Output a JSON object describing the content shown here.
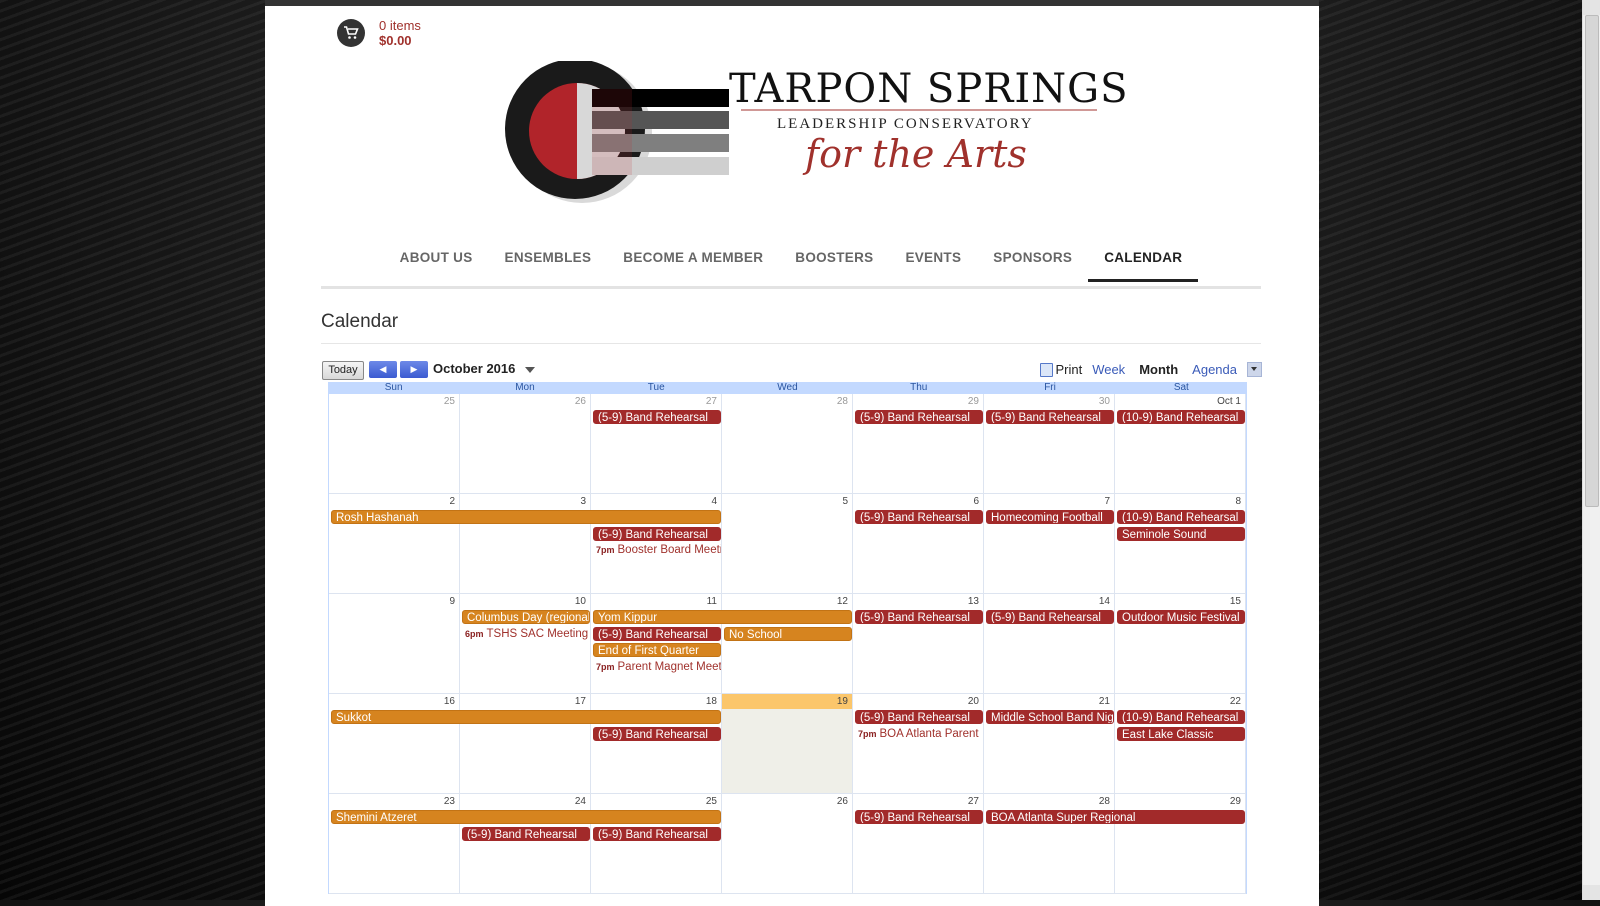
{
  "cart": {
    "items": "0 items",
    "total": "$0.00"
  },
  "brand": {
    "title": "TARPON SPRINGS",
    "subtitle": "LEADERSHIP CONSERVATORY",
    "script": "for the Arts"
  },
  "nav": [
    {
      "label": "ABOUT US"
    },
    {
      "label": "ENSEMBLES"
    },
    {
      "label": "BECOME A MEMBER"
    },
    {
      "label": "BOOSTERS"
    },
    {
      "label": "EVENTS"
    },
    {
      "label": "SPONSORS"
    },
    {
      "label": "CALENDAR",
      "active": true
    }
  ],
  "page": {
    "title": "Calendar"
  },
  "calendar": {
    "today_label": "Today",
    "prev_icon": "chevron-left-icon",
    "next_icon": "chevron-right-icon",
    "current": "October 2016",
    "print_label": "Print",
    "tabs": [
      {
        "label": "Week"
      },
      {
        "label": "Month",
        "active": true
      },
      {
        "label": "Agenda"
      }
    ],
    "days_of_week": [
      "Sun",
      "Mon",
      "Tue",
      "Wed",
      "Thu",
      "Fri",
      "Sat"
    ],
    "today_date": "19",
    "event_colors": {
      "red": "#a22a2a",
      "orange": "#d6841f"
    },
    "weeks": [
      {
        "days": [
          {
            "num": "25",
            "other": true
          },
          {
            "num": "26",
            "other": true
          },
          {
            "num": "27",
            "other": true
          },
          {
            "num": "28",
            "other": true
          },
          {
            "num": "29",
            "other": true
          },
          {
            "num": "30",
            "other": true
          },
          {
            "num": "Oct 1"
          }
        ],
        "events": [
          {
            "start": 2,
            "span": 1,
            "row": 0,
            "label": "(5-9) Band Rehearsal",
            "color": "red"
          },
          {
            "start": 4,
            "span": 1,
            "row": 0,
            "label": "(5-9) Band Rehearsal",
            "color": "red"
          },
          {
            "start": 5,
            "span": 1,
            "row": 0,
            "label": "(5-9) Band Rehearsal",
            "color": "red"
          },
          {
            "start": 6,
            "span": 1,
            "row": 0,
            "label": "(10-9) Band Rehearsal",
            "color": "red"
          }
        ]
      },
      {
        "days": [
          {
            "num": "2"
          },
          {
            "num": "3"
          },
          {
            "num": "4"
          },
          {
            "num": "5"
          },
          {
            "num": "6"
          },
          {
            "num": "7"
          },
          {
            "num": "8"
          }
        ],
        "events": [
          {
            "start": 0,
            "span": 3,
            "row": 0,
            "label": "Rosh Hashanah",
            "color": "orange"
          },
          {
            "start": 4,
            "span": 1,
            "row": 0,
            "label": "(5-9) Band Rehearsal",
            "color": "red"
          },
          {
            "start": 5,
            "span": 1,
            "row": 0,
            "label": "Homecoming Football",
            "color": "red"
          },
          {
            "start": 6,
            "span": 1,
            "row": 0,
            "label": "(10-9) Band Rehearsal",
            "color": "red"
          },
          {
            "start": 2,
            "span": 1,
            "row": 1,
            "label": "(5-9) Band Rehearsal",
            "color": "red"
          },
          {
            "start": 6,
            "span": 1,
            "row": 1,
            "label": "Seminole Sound",
            "color": "red"
          },
          {
            "start": 2,
            "span": 1,
            "row": 2,
            "time": "7pm",
            "label": "Booster Board Meeting",
            "color": "timed"
          }
        ]
      },
      {
        "days": [
          {
            "num": "9"
          },
          {
            "num": "10"
          },
          {
            "num": "11"
          },
          {
            "num": "12"
          },
          {
            "num": "13"
          },
          {
            "num": "14"
          },
          {
            "num": "15"
          }
        ],
        "events": [
          {
            "start": 1,
            "span": 1,
            "row": 0,
            "label": "Columbus Day (regional)",
            "color": "orange"
          },
          {
            "start": 2,
            "span": 2,
            "row": 0,
            "label": "Yom Kippur",
            "color": "orange"
          },
          {
            "start": 4,
            "span": 1,
            "row": 0,
            "label": "(5-9) Band Rehearsal",
            "color": "red"
          },
          {
            "start": 5,
            "span": 1,
            "row": 0,
            "label": "(5-9) Band Rehearsal",
            "color": "red"
          },
          {
            "start": 6,
            "span": 1,
            "row": 0,
            "label": "Outdoor Music Festival",
            "color": "red"
          },
          {
            "start": 1,
            "span": 1,
            "row": 1,
            "time": "6pm",
            "label": "TSHS SAC Meeting",
            "color": "timed"
          },
          {
            "start": 2,
            "span": 1,
            "row": 1,
            "label": "(5-9) Band Rehearsal",
            "color": "red"
          },
          {
            "start": 3,
            "span": 1,
            "row": 1,
            "label": "No School",
            "color": "orange"
          },
          {
            "start": 2,
            "span": 1,
            "row": 2,
            "label": "End of First Quarter",
            "color": "orange"
          },
          {
            "start": 2,
            "span": 1,
            "row": 3,
            "time": "7pm",
            "label": "Parent Magnet Meeting",
            "color": "timed"
          }
        ]
      },
      {
        "days": [
          {
            "num": "16"
          },
          {
            "num": "17"
          },
          {
            "num": "18"
          },
          {
            "num": "19",
            "today": true
          },
          {
            "num": "20"
          },
          {
            "num": "21"
          },
          {
            "num": "22"
          }
        ],
        "events": [
          {
            "start": 0,
            "span": 3,
            "row": 0,
            "label": "Sukkot",
            "color": "orange"
          },
          {
            "start": 4,
            "span": 1,
            "row": 0,
            "label": "(5-9) Band Rehearsal",
            "color": "red"
          },
          {
            "start": 5,
            "span": 1,
            "row": 0,
            "label": "Middle School Band Night",
            "color": "red"
          },
          {
            "start": 6,
            "span": 1,
            "row": 0,
            "label": "(10-9) Band Rehearsal",
            "color": "red"
          },
          {
            "start": 2,
            "span": 1,
            "row": 1,
            "label": "(5-9) Band Rehearsal",
            "color": "red"
          },
          {
            "start": 4,
            "span": 1,
            "row": 1,
            "time": "7pm",
            "label": "BOA Atlanta Parent",
            "color": "timed"
          },
          {
            "start": 6,
            "span": 1,
            "row": 1,
            "label": "East Lake Classic",
            "color": "red"
          }
        ]
      },
      {
        "days": [
          {
            "num": "23"
          },
          {
            "num": "24"
          },
          {
            "num": "25"
          },
          {
            "num": "26"
          },
          {
            "num": "27"
          },
          {
            "num": "28"
          },
          {
            "num": "29"
          }
        ],
        "events": [
          {
            "start": 0,
            "span": 3,
            "row": 0,
            "label": "Shemini Atzeret",
            "color": "orange"
          },
          {
            "start": 4,
            "span": 1,
            "row": 0,
            "label": "(5-9) Band Rehearsal",
            "color": "red"
          },
          {
            "start": 5,
            "span": 2,
            "row": 0,
            "label": "BOA Atlanta Super Regional",
            "color": "red"
          },
          {
            "start": 1,
            "span": 1,
            "row": 1,
            "label": "(5-9) Band Rehearsal",
            "color": "red"
          },
          {
            "start": 2,
            "span": 1,
            "row": 1,
            "label": "(5-9) Band Rehearsal",
            "color": "red"
          }
        ]
      }
    ]
  }
}
